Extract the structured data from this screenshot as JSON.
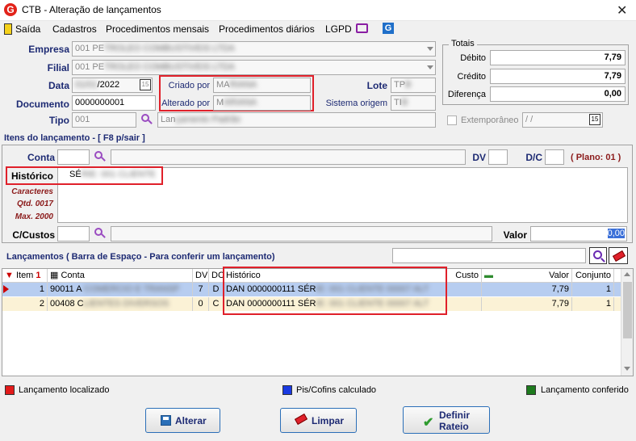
{
  "window": {
    "title": "CTB - Alteração de lançamentos",
    "app_icon": "G"
  },
  "menu": {
    "items": [
      "Saída",
      "Cadastros",
      "Procedimentos mensais",
      "Procedimentos diários",
      "LGPD"
    ]
  },
  "header": {
    "empresa_label": "Empresa",
    "empresa_value": "001 PE",
    "filial_label": "Filial",
    "filial_value": "001 PE",
    "data_label": "Data",
    "data_value": "/2022",
    "documento_label": "Documento",
    "documento_value": "0000000001",
    "tipo_label": "Tipo",
    "tipo_value": "001",
    "tipo_desc": "Lan",
    "criado_label": "Criado por",
    "criado_value": "MA",
    "alterado_label": "Alterado por",
    "alterado_value": "M",
    "lote_label": "Lote",
    "lote_value": "TP",
    "sistema_label": "Sistema origem",
    "sistema_value": "TI",
    "extemporaneo_label": "Extemporâneo",
    "extemporaneo_value": " /  /"
  },
  "totais": {
    "title": "Totais",
    "debito_label": "Débito",
    "debito_value": "7,79",
    "credito_label": "Crédito",
    "credito_value": "7,79",
    "diferenca_label": "Diferença",
    "diferenca_value": "0,00"
  },
  "itens": {
    "title": "Itens do lançamento - [ F8 p/sair ]",
    "conta_label": "Conta",
    "dv_label": "DV",
    "dc_label": "D/C",
    "plano": "( Plano: 01 )",
    "historico_label": "Histórico",
    "historico_value": "SÉ",
    "caracteres": "Caracteres",
    "qtd": "Qtd. 0017",
    "max": "Max. 2000",
    "ccustos_label": "C/Custos",
    "valor_label": "Valor",
    "valor_value": "0,00"
  },
  "lancamentos": {
    "title": "Lançamentos ( Barra de Espaço - Para conferir um lançamento)",
    "columns": [
      "Item",
      "Conta",
      "DV",
      "DC",
      "Histórico",
      "Custo",
      "Valor",
      "Conjunto"
    ],
    "rows": [
      {
        "item": "1",
        "conta": "90011 A",
        "dv": "7",
        "dc": "D",
        "historico": "DAN 0000000111 SÉR",
        "custo": "",
        "valor": "7,79",
        "conjunto": "1"
      },
      {
        "item": "2",
        "conta": "00408 C",
        "dv": "0",
        "dc": "C",
        "historico": "DAN 0000000111 SÉR",
        "custo": "",
        "valor": "7,79",
        "conjunto": "1"
      }
    ]
  },
  "legend": {
    "localizado": "Lançamento localizado",
    "pis": "Pis/Cofins calculado",
    "conferido": "Lançamento conferido"
  },
  "buttons": {
    "alterar": "Alterar",
    "limpar": "Limpar",
    "definir": "Definir",
    "rateio": "Rateio"
  },
  "colors": {
    "red_highlight": "#e0202a",
    "selected_row": "#b7cdf0",
    "accent": "#1d2a73"
  }
}
